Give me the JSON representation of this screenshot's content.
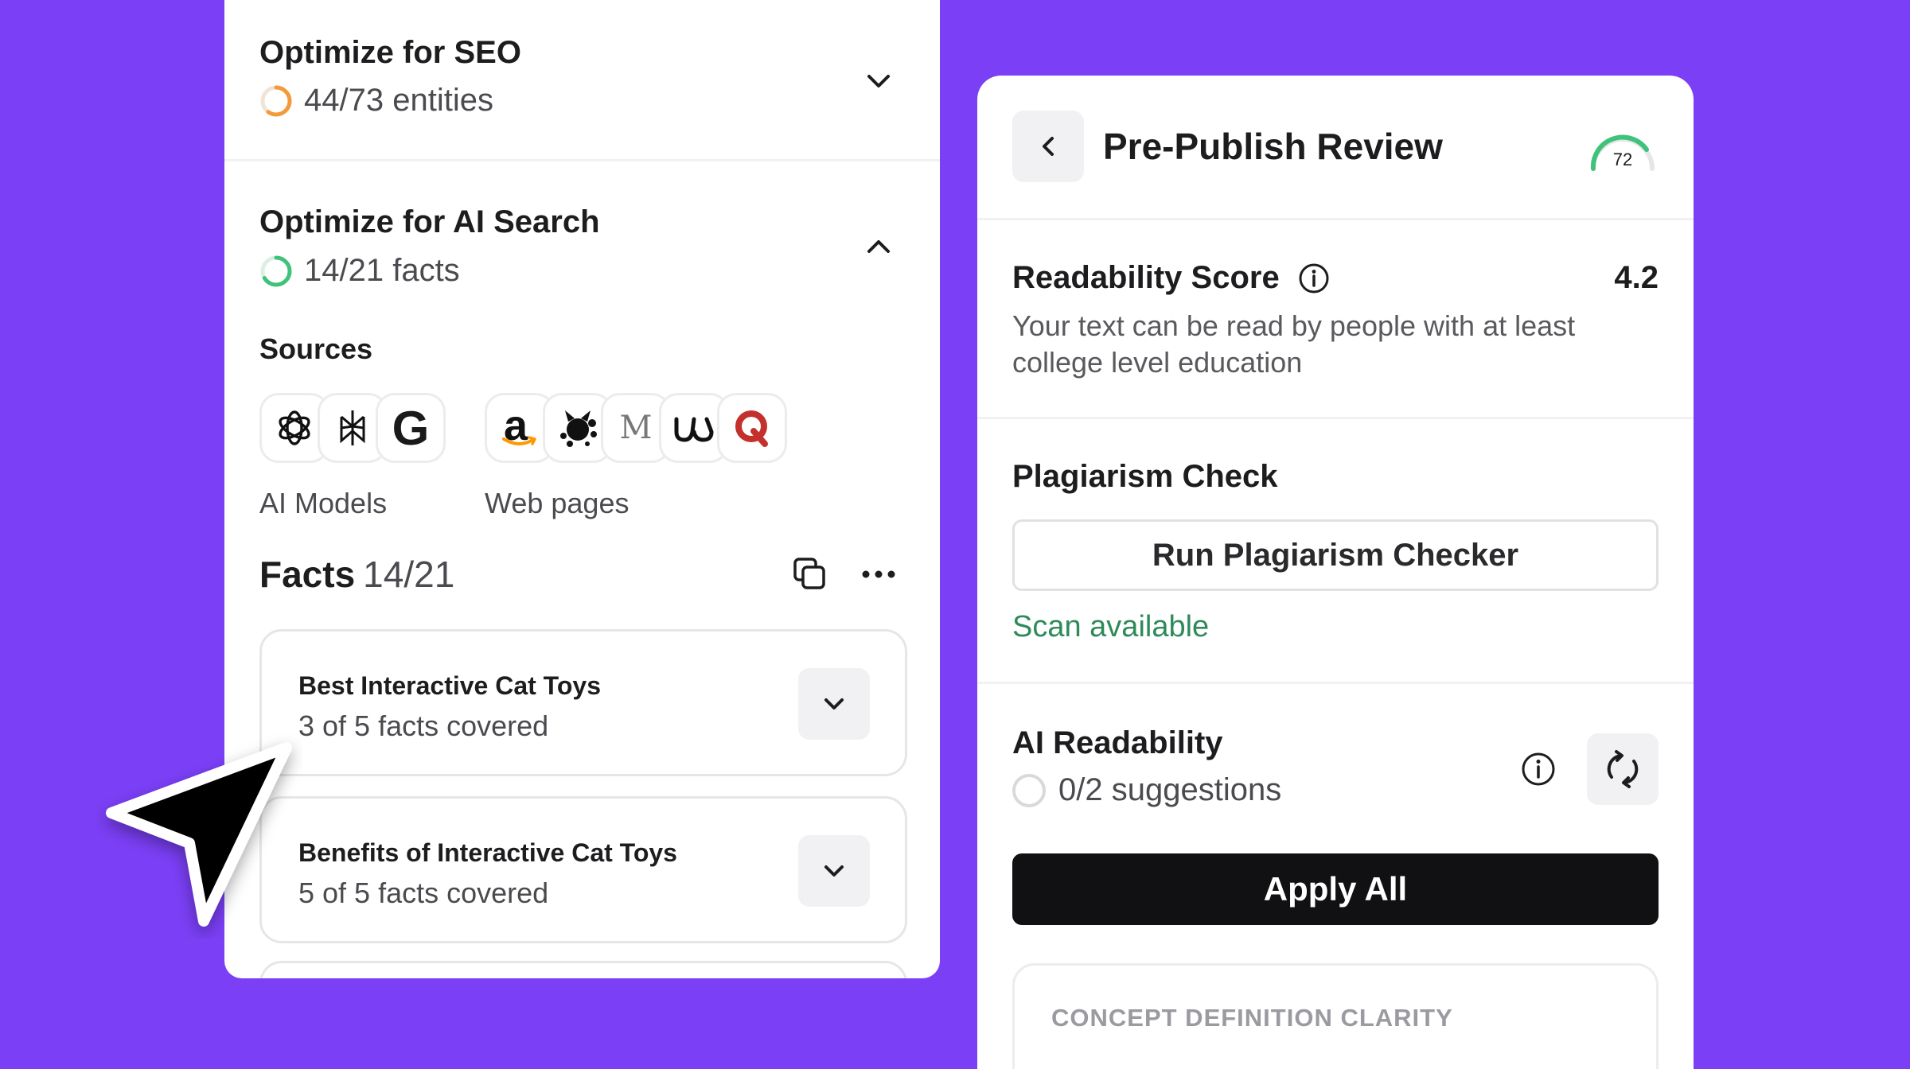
{
  "colors": {
    "background": "#7b3ff6",
    "seo_ring": "#f39a3a",
    "ai_ring": "#3fc27a",
    "scan_link": "#2f8a5a",
    "gauge": "#3fc27a",
    "apply_button": "#111113"
  },
  "seo": {
    "title": "Optimize for SEO",
    "progress_text": "44/73 entities",
    "progress_value": 0.6,
    "expanded": false
  },
  "ai_search": {
    "title": "Optimize for AI Search",
    "progress_text": "14/21 facts",
    "progress_value": 0.667,
    "expanded": true
  },
  "sources": {
    "label": "Sources",
    "ai_models": {
      "label": "AI Models",
      "icons": [
        "openai-icon",
        "perplexity-icon",
        "google-icon"
      ]
    },
    "web_pages": {
      "label": "Web pages",
      "icons": [
        "amazon-icon",
        "catster-icon",
        "medium-icon",
        "jackson-galaxy-icon",
        "quora-icon"
      ],
      "glyphs": {
        "amazon": "a",
        "medium": "M",
        "google": "G"
      }
    }
  },
  "facts": {
    "title": "Facts",
    "count": "14/21",
    "items": [
      {
        "title": "Best Interactive Cat Toys",
        "subtitle": "3 of 5 facts covered"
      },
      {
        "title": "Benefits of Interactive Cat Toys",
        "subtitle": "5 of 5 facts covered"
      }
    ]
  },
  "review": {
    "title": "Pre-Publish Review",
    "score": "72",
    "score_value": 0.72,
    "readability": {
      "title": "Readability Score",
      "value": "4.2",
      "description": "Your text can be read by people with at least college level education"
    },
    "plagiarism": {
      "title": "Plagiarism Check",
      "button": "Run Plagiarism Checker",
      "status": "Scan available"
    },
    "ai_readability": {
      "title": "AI Readability",
      "suggestions": "0/2 suggestions",
      "apply_button": "Apply All"
    },
    "concept": {
      "label": "CONCEPT DEFINITION CLARITY"
    }
  }
}
